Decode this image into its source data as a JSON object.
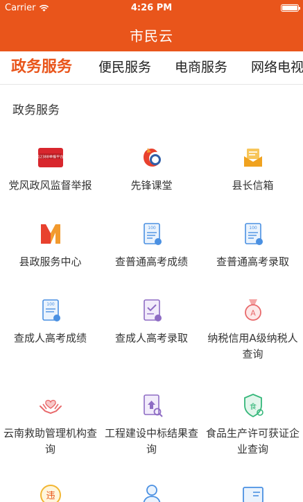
{
  "status_bar": {
    "carrier": "Carrier",
    "time": "4:26 PM"
  },
  "nav": {
    "title": "市民云"
  },
  "tabs": [
    {
      "label": "政务服务",
      "active": true
    },
    {
      "label": "便民服务",
      "active": false
    },
    {
      "label": "电商服务",
      "active": false
    },
    {
      "label": "网络电视",
      "active": false
    }
  ],
  "section": {
    "title": "政务服务"
  },
  "grid": [
    {
      "label": "党风政风监督举报",
      "icon": "report-hotline-icon",
      "badge": "12388举报平台"
    },
    {
      "label": "先锋课堂",
      "icon": "pioneer-class-icon"
    },
    {
      "label": "县长信箱",
      "icon": "mailbox-icon"
    },
    {
      "label": "县政服务中心",
      "icon": "service-center-icon"
    },
    {
      "label": "查普通高考成绩",
      "icon": "exam-score-icon",
      "badge": "100"
    },
    {
      "label": "查普通高考录取",
      "icon": "exam-admission-icon",
      "badge": "100"
    },
    {
      "label": "查成人高考成绩",
      "icon": "adult-exam-score-icon",
      "badge": "100"
    },
    {
      "label": "查成人高考录取",
      "icon": "adult-exam-admission-icon"
    },
    {
      "label": "纳税信用A级纳税人查询",
      "icon": "tax-credit-medal-icon",
      "badge": "A"
    },
    {
      "label": "云南救助管理机构查询",
      "icon": "rescue-hands-icon"
    },
    {
      "label": "工程建设中标结果查询",
      "icon": "bidding-result-icon"
    },
    {
      "label": "食品生产许可获证企业查询",
      "icon": "food-license-shield-icon",
      "badge": "食"
    },
    {
      "label": "",
      "icon": "violation-icon",
      "badge": "违"
    },
    {
      "label": "",
      "icon": "doctor-icon"
    },
    {
      "label": "",
      "icon": "certificate-icon"
    }
  ],
  "colors": {
    "brand": "#e9551b",
    "icon_blue": "#4a90e2",
    "icon_purple": "#8e6cc4",
    "icon_pink": "#e8696b",
    "icon_green": "#35b77a",
    "icon_yellow": "#f2b632"
  }
}
